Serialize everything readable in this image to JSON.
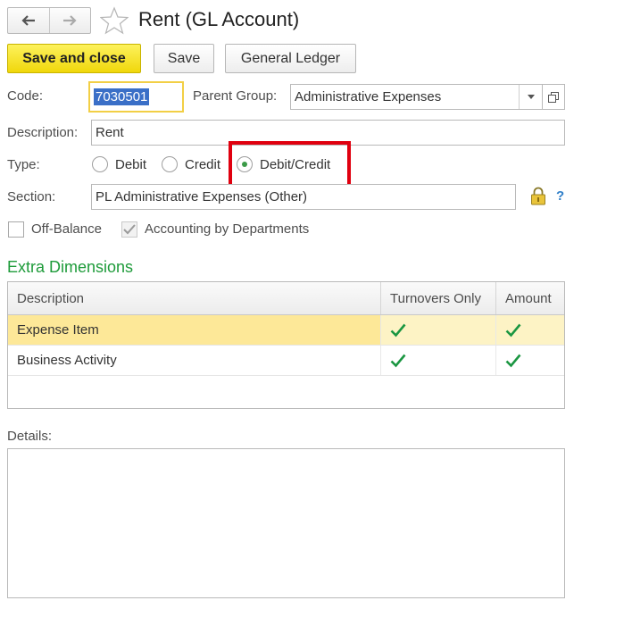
{
  "window": {
    "title": "Rent (GL Account)"
  },
  "nav": {
    "back_icon": "arrow-left-icon",
    "forward_icon": "arrow-right-icon",
    "favorite_icon": "star-icon"
  },
  "toolbar": {
    "save_close_label": "Save and close",
    "save_label": "Save",
    "general_ledger_label": "General Ledger"
  },
  "form": {
    "code_label": "Code:",
    "code_value": "7030501",
    "parent_group_label": "Parent Group:",
    "parent_group_value": "Administrative Expenses",
    "description_label": "Description:",
    "description_value": "Rent",
    "type_label": "Type:",
    "type_options": [
      {
        "label": "Debit",
        "selected": false
      },
      {
        "label": "Credit",
        "selected": false
      },
      {
        "label": "Debit/Credit",
        "selected": true
      }
    ],
    "section_label": "Section:",
    "section_value": "PL Administrative Expenses (Other)",
    "help_label": "?",
    "off_balance_label": "Off-Balance",
    "off_balance_checked": false,
    "by_departments_label": "Accounting by Departments",
    "by_departments_checked": true
  },
  "extra_dimensions": {
    "heading": "Extra Dimensions",
    "columns": [
      "Description",
      "Turnovers Only",
      "Amount"
    ],
    "rows": [
      {
        "description": "Expense Item",
        "turnovers_only": true,
        "amount": true,
        "selected": true
      },
      {
        "description": "Business Activity",
        "turnovers_only": true,
        "amount": true,
        "selected": false
      }
    ]
  },
  "details": {
    "label": "Details:",
    "value": ""
  },
  "colors": {
    "accent_yellow": "#f5de23",
    "heading_green": "#1e9b3a",
    "check_green": "#1a9641",
    "highlight_red": "#e0000f",
    "selected_row": "#fde898"
  }
}
